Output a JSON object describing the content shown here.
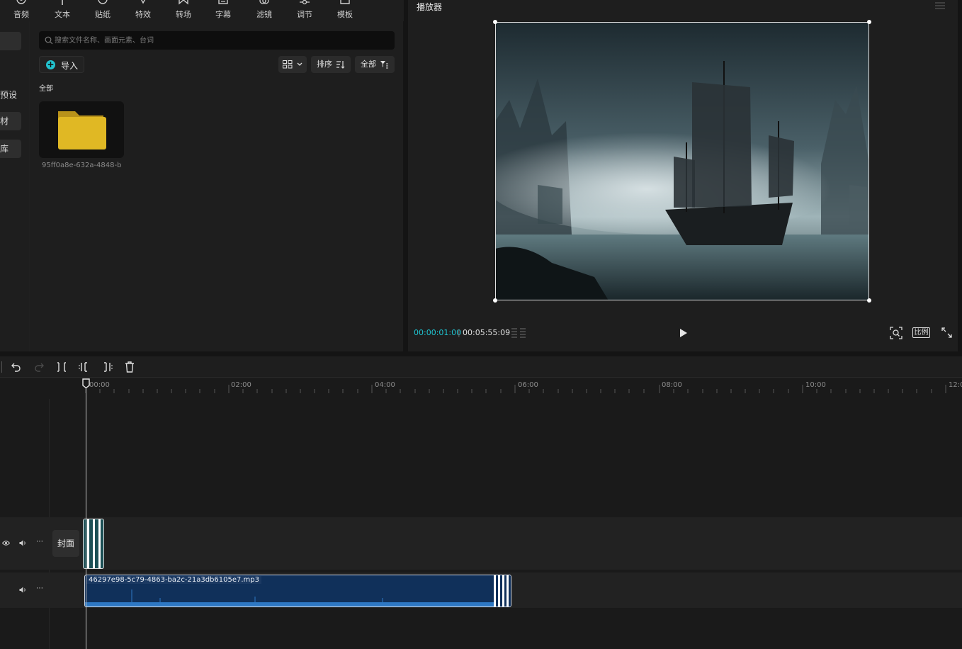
{
  "toolbar": {
    "items": [
      {
        "label": "音频",
        "icon": "audio-icon"
      },
      {
        "label": "文本",
        "icon": "text-icon"
      },
      {
        "label": "贴纸",
        "icon": "sticker-icon"
      },
      {
        "label": "特效",
        "icon": "effects-icon"
      },
      {
        "label": "转场",
        "icon": "transition-icon"
      },
      {
        "label": "字幕",
        "icon": "caption-icon"
      },
      {
        "label": "滤镜",
        "icon": "filter-icon"
      },
      {
        "label": "调节",
        "icon": "adjust-icon"
      },
      {
        "label": "模板",
        "icon": "template-icon"
      }
    ]
  },
  "leftnav": {
    "items": [
      {
        "label": "预设"
      },
      {
        "label": "材"
      },
      {
        "label": "库"
      }
    ]
  },
  "media": {
    "search_placeholder": "搜索文件名称、画面元素、台词",
    "import_label": "导入",
    "sort_label": "排序",
    "filter_label": "全部",
    "section_label": "全部",
    "folder_name": "95ff0a8e-632a-4848-b"
  },
  "player": {
    "title": "播放器",
    "current_time": "00:00:01:00",
    "separator": "|",
    "total_time": "00:05:55:09",
    "ratio_label": "比例"
  },
  "timeline": {
    "ruler_labels": [
      "00:00",
      "02:00",
      "04:00",
      "06:00",
      "08:00",
      "10:00",
      "12:0"
    ],
    "cover_label": "封面",
    "audio_clip_name": "46297e98-5c79-4863-ba2c-21a3db6105e7.mp3"
  },
  "colors": {
    "accent": "#1fc3d0",
    "folder": "#e0b824",
    "audio_clip": "#10305a",
    "video_clip": "#1b4f55"
  }
}
